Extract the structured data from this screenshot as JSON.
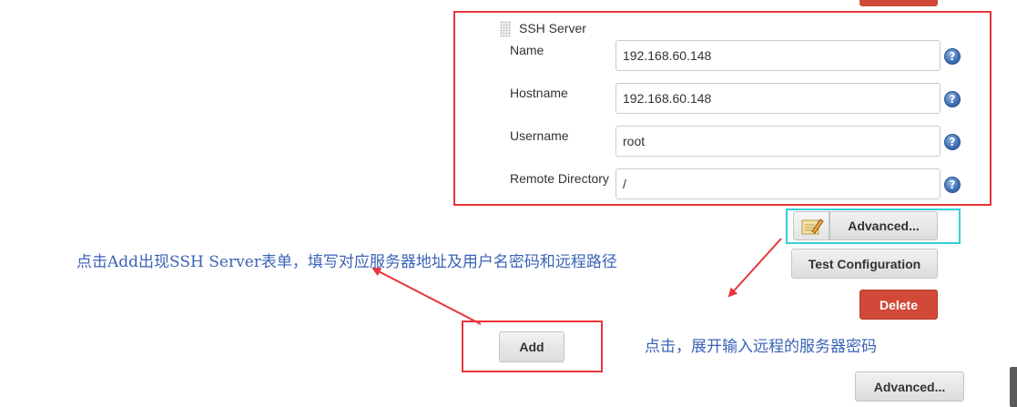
{
  "ssh_server": {
    "title": "SSH Server",
    "fields": [
      {
        "label": "Name",
        "value": "192.168.60.148"
      },
      {
        "label": "Hostname",
        "value": "192.168.60.148"
      },
      {
        "label": "Username",
        "value": "root"
      },
      {
        "label": "Remote Directory",
        "value": "/"
      }
    ],
    "help_glyph": "?"
  },
  "buttons": {
    "advanced": "Advanced...",
    "test_configuration": "Test Configuration",
    "delete": "Delete",
    "add": "Add",
    "advanced_bottom": "Advanced..."
  },
  "annotations": {
    "left_note": "点击Add出现SSH Server表单，填写对应服务器地址及用户名密码和远程路径",
    "right_note": "点击，展开输入远程的服务器密码"
  },
  "colors": {
    "highlight_red": "#e8343a",
    "highlight_cyan": "#33cfd6",
    "delete_red": "#d24939",
    "note_blue": "#3a63b6"
  },
  "icons": [
    "help-icon",
    "notepad-icon",
    "drag-handle-icon"
  ]
}
